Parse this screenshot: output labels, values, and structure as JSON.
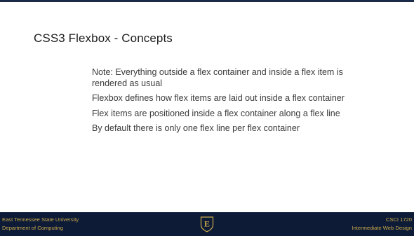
{
  "slide": {
    "title": "CSS3 Flexbox - Concepts",
    "bullets": [
      "Note: Everything outside a flex container and inside a flex item is rendered as usual",
      "Flexbox defines how flex items are laid out inside a flex container",
      "Flex items are positioned inside a flex container along a flex line",
      "By default there is only one flex line per flex container"
    ]
  },
  "footer": {
    "left_line1": "East Tennessee State University",
    "left_line2": "Department of Computing",
    "right_line1": "CSCI 1720",
    "right_line2": "Intermediate Web Design",
    "logo_letter": "E"
  },
  "colors": {
    "footer_bg": "#0e1b36",
    "footer_text": "#c9a94a",
    "title_text": "#1d1d1d",
    "body_text": "#3b3b3b"
  },
  "icons": {
    "logo": "etsu-shield-logo-icon"
  }
}
